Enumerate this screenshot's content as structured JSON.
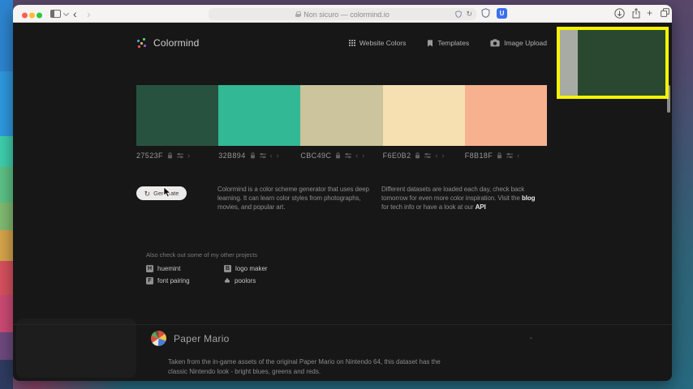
{
  "browser": {
    "url_text": "Non sicuro — colormind.io",
    "extension_badge": "U"
  },
  "header": {
    "brand": "Colormind",
    "nav": [
      {
        "label": "Website Colors"
      },
      {
        "label": "Templates"
      },
      {
        "label": "Image Upload"
      }
    ]
  },
  "palette": {
    "swatches": [
      {
        "hex": "27523F",
        "color": "#27523F"
      },
      {
        "hex": "32B894",
        "color": "#32B894"
      },
      {
        "hex": "CBC49C",
        "color": "#CBC49C"
      },
      {
        "hex": "F6E0B2",
        "color": "#F6E0B2"
      },
      {
        "hex": "F8B18F",
        "color": "#F8B18F"
      }
    ]
  },
  "generate": {
    "label": "Generate"
  },
  "about": {
    "p1": "Colormind is a color scheme generator that uses deep learning. It can learn color styles from photographs, movies, and popular art.",
    "p2_text1": "Different datasets are loaded each day, check back tomorrow for even more color inspiration. Visit the ",
    "p2_link1": "blog",
    "p2_text2": " for tech info or have a look at our ",
    "p2_link2": "API"
  },
  "projects": {
    "heading": "Also check out some of my other projects",
    "items": [
      {
        "label": "huemint",
        "icon_letter": "H"
      },
      {
        "label": "logo maker",
        "icon_letter": "B"
      },
      {
        "label": "font pairing",
        "icon_letter": "F"
      },
      {
        "label": "poolors"
      }
    ]
  },
  "dataset": {
    "title": "Paper Mario",
    "collapse_glyph": "-",
    "description": "Taken from the in-game assets of the original Paper Mario on Nintendo 64, this dataset has the classic Nintendo look - bright blues, greens and reds."
  },
  "colors": {
    "highlight_border": "#F6F400",
    "page_background": "#171717",
    "titlebar_background": "#F5F4F2"
  },
  "icons": {
    "window_controls": [
      "close",
      "minimize",
      "zoom"
    ],
    "nav_icons": [
      "grid-icon",
      "bookmark-icon",
      "camera-icon"
    ],
    "swatch_controls": [
      "lock-icon",
      "sliders-icon",
      "arrow-left-icon",
      "arrow-right-icon"
    ],
    "generate_icon": "refresh-icon"
  }
}
